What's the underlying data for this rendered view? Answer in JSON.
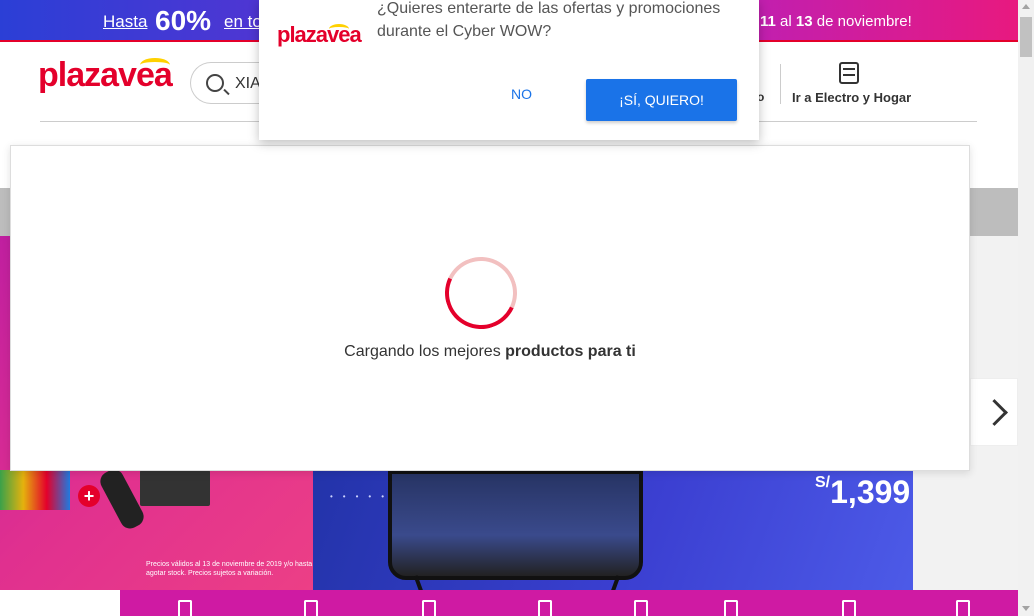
{
  "promo": {
    "hasta": "Hasta",
    "percent": "60%",
    "en_to": "en to",
    "dates_11": "11",
    "dates_al": "al",
    "dates_13": "13",
    "dates_rest": "de noviembre!"
  },
  "header": {
    "logo_part1": "plaza",
    "logo_part2": "vea",
    "search_value": "XIA",
    "cut_link": "o",
    "electro_link": "Ir a Electro y Hogar"
  },
  "notification": {
    "logo_part1": "plaza",
    "logo_part2": "vea",
    "message": "¿Quieres enterarte de las ofertas y promociones durante el Cyber WOW?",
    "no_label": "NO",
    "yes_label": "¡SÍ, QUIERO!"
  },
  "loading": {
    "text_regular": "Cargando los mejores ",
    "text_bold": "productos para ti"
  },
  "banner": {
    "price_currency": "S/",
    "price_value": "1,399",
    "fine_print": "Precios válidos al 13 de noviembre de 2019 y/o hasta agotar stock. Precios sujetos a variación."
  },
  "colors": {
    "brand_red": "#e4002b",
    "brand_yellow": "#ffd100",
    "accent_blue": "#1a73e8",
    "category_magenta": "#cf1aa3"
  },
  "icons": [
    "search-icon",
    "appliance-icon",
    "chevron-right-icon",
    "plus-icon"
  ]
}
